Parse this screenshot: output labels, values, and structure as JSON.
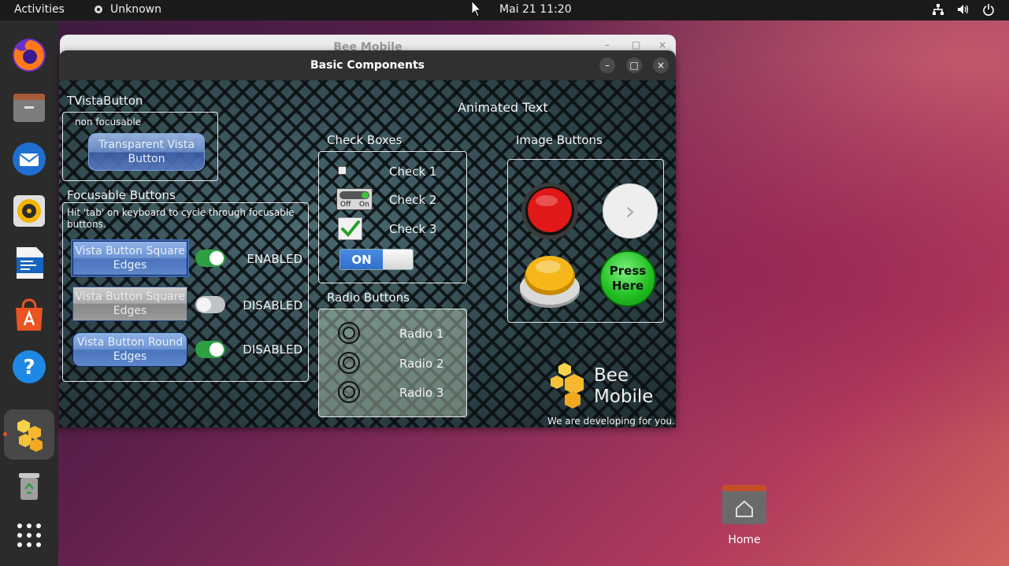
{
  "topbar": {
    "activities": "Activities",
    "app_name": "Unknown",
    "datetime": "Mai 21  11:20"
  },
  "dock": {
    "items": [
      "firefox",
      "files",
      "thunderbird",
      "rhythmbox",
      "writer",
      "app-center",
      "help",
      "bee-mobile",
      "trash",
      "show-apps"
    ]
  },
  "back_window": {
    "title": "Bee Mobile"
  },
  "window": {
    "title": "Basic Components",
    "minimize": "–",
    "maximize": "□",
    "close": "×"
  },
  "tvista": {
    "heading": "TVistaButton",
    "note": "non focusable",
    "button_label": "Transparent Vista Button"
  },
  "focusable": {
    "heading": "Focusable Buttons",
    "hint": "Hit 'tab' on keyboard to cycle through focusable buttons.",
    "rows": [
      {
        "button": "Vista Button Square Edges",
        "state": "ENABLED",
        "switch_on": true
      },
      {
        "button": "Vista Button Square Edges",
        "state": "DISABLED",
        "switch_on": false
      },
      {
        "button": "Vista Button Round Edges",
        "state": "DISABLED",
        "switch_on": true
      }
    ]
  },
  "animated_text": "Animated Text",
  "checkboxes": {
    "heading": "Check Boxes",
    "items": [
      "Check 1",
      "Check 2",
      "Check 3"
    ],
    "offon_off": "Off",
    "offon_on": "On",
    "toggle_on": "ON"
  },
  "radios": {
    "heading": "Radio Buttons",
    "items": [
      "Radio 1",
      "Radio 2",
      "Radio 3"
    ]
  },
  "image_buttons": {
    "heading": "Image Buttons",
    "press_here": "Press Here",
    "chevron": "›"
  },
  "brand": {
    "line1": "Bee",
    "line2": "Mobile",
    "tagline": "We are developing for you."
  },
  "desktop": {
    "home_label": "Home"
  },
  "colors": {
    "accent": "#e95420",
    "switch_on": "#2ea043",
    "titlebar": "#303030"
  }
}
